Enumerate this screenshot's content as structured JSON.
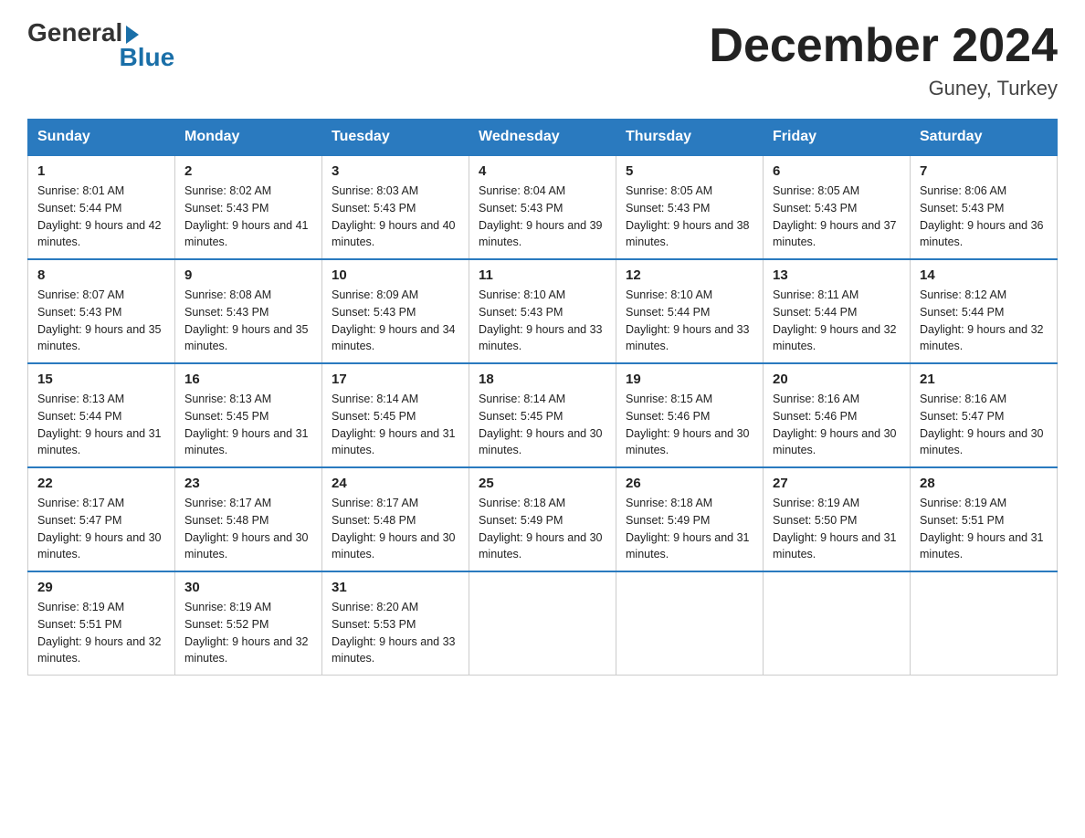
{
  "logo": {
    "general": "General",
    "blue": "Blue"
  },
  "title": "December 2024",
  "subtitle": "Guney, Turkey",
  "days_header": [
    "Sunday",
    "Monday",
    "Tuesday",
    "Wednesday",
    "Thursday",
    "Friday",
    "Saturday"
  ],
  "weeks": [
    [
      {
        "day": "1",
        "sunrise": "8:01 AM",
        "sunset": "5:44 PM",
        "daylight": "9 hours and 42 minutes."
      },
      {
        "day": "2",
        "sunrise": "8:02 AM",
        "sunset": "5:43 PM",
        "daylight": "9 hours and 41 minutes."
      },
      {
        "day": "3",
        "sunrise": "8:03 AM",
        "sunset": "5:43 PM",
        "daylight": "9 hours and 40 minutes."
      },
      {
        "day": "4",
        "sunrise": "8:04 AM",
        "sunset": "5:43 PM",
        "daylight": "9 hours and 39 minutes."
      },
      {
        "day": "5",
        "sunrise": "8:05 AM",
        "sunset": "5:43 PM",
        "daylight": "9 hours and 38 minutes."
      },
      {
        "day": "6",
        "sunrise": "8:05 AM",
        "sunset": "5:43 PM",
        "daylight": "9 hours and 37 minutes."
      },
      {
        "day": "7",
        "sunrise": "8:06 AM",
        "sunset": "5:43 PM",
        "daylight": "9 hours and 36 minutes."
      }
    ],
    [
      {
        "day": "8",
        "sunrise": "8:07 AM",
        "sunset": "5:43 PM",
        "daylight": "9 hours and 35 minutes."
      },
      {
        "day": "9",
        "sunrise": "8:08 AM",
        "sunset": "5:43 PM",
        "daylight": "9 hours and 35 minutes."
      },
      {
        "day": "10",
        "sunrise": "8:09 AM",
        "sunset": "5:43 PM",
        "daylight": "9 hours and 34 minutes."
      },
      {
        "day": "11",
        "sunrise": "8:10 AM",
        "sunset": "5:43 PM",
        "daylight": "9 hours and 33 minutes."
      },
      {
        "day": "12",
        "sunrise": "8:10 AM",
        "sunset": "5:44 PM",
        "daylight": "9 hours and 33 minutes."
      },
      {
        "day": "13",
        "sunrise": "8:11 AM",
        "sunset": "5:44 PM",
        "daylight": "9 hours and 32 minutes."
      },
      {
        "day": "14",
        "sunrise": "8:12 AM",
        "sunset": "5:44 PM",
        "daylight": "9 hours and 32 minutes."
      }
    ],
    [
      {
        "day": "15",
        "sunrise": "8:13 AM",
        "sunset": "5:44 PM",
        "daylight": "9 hours and 31 minutes."
      },
      {
        "day": "16",
        "sunrise": "8:13 AM",
        "sunset": "5:45 PM",
        "daylight": "9 hours and 31 minutes."
      },
      {
        "day": "17",
        "sunrise": "8:14 AM",
        "sunset": "5:45 PM",
        "daylight": "9 hours and 31 minutes."
      },
      {
        "day": "18",
        "sunrise": "8:14 AM",
        "sunset": "5:45 PM",
        "daylight": "9 hours and 30 minutes."
      },
      {
        "day": "19",
        "sunrise": "8:15 AM",
        "sunset": "5:46 PM",
        "daylight": "9 hours and 30 minutes."
      },
      {
        "day": "20",
        "sunrise": "8:16 AM",
        "sunset": "5:46 PM",
        "daylight": "9 hours and 30 minutes."
      },
      {
        "day": "21",
        "sunrise": "8:16 AM",
        "sunset": "5:47 PM",
        "daylight": "9 hours and 30 minutes."
      }
    ],
    [
      {
        "day": "22",
        "sunrise": "8:17 AM",
        "sunset": "5:47 PM",
        "daylight": "9 hours and 30 minutes."
      },
      {
        "day": "23",
        "sunrise": "8:17 AM",
        "sunset": "5:48 PM",
        "daylight": "9 hours and 30 minutes."
      },
      {
        "day": "24",
        "sunrise": "8:17 AM",
        "sunset": "5:48 PM",
        "daylight": "9 hours and 30 minutes."
      },
      {
        "day": "25",
        "sunrise": "8:18 AM",
        "sunset": "5:49 PM",
        "daylight": "9 hours and 30 minutes."
      },
      {
        "day": "26",
        "sunrise": "8:18 AM",
        "sunset": "5:49 PM",
        "daylight": "9 hours and 31 minutes."
      },
      {
        "day": "27",
        "sunrise": "8:19 AM",
        "sunset": "5:50 PM",
        "daylight": "9 hours and 31 minutes."
      },
      {
        "day": "28",
        "sunrise": "8:19 AM",
        "sunset": "5:51 PM",
        "daylight": "9 hours and 31 minutes."
      }
    ],
    [
      {
        "day": "29",
        "sunrise": "8:19 AM",
        "sunset": "5:51 PM",
        "daylight": "9 hours and 32 minutes."
      },
      {
        "day": "30",
        "sunrise": "8:19 AM",
        "sunset": "5:52 PM",
        "daylight": "9 hours and 32 minutes."
      },
      {
        "day": "31",
        "sunrise": "8:20 AM",
        "sunset": "5:53 PM",
        "daylight": "9 hours and 33 minutes."
      },
      null,
      null,
      null,
      null
    ]
  ],
  "colors": {
    "header_bg": "#2a7abf",
    "header_text": "#ffffff",
    "border": "#2a7abf"
  }
}
